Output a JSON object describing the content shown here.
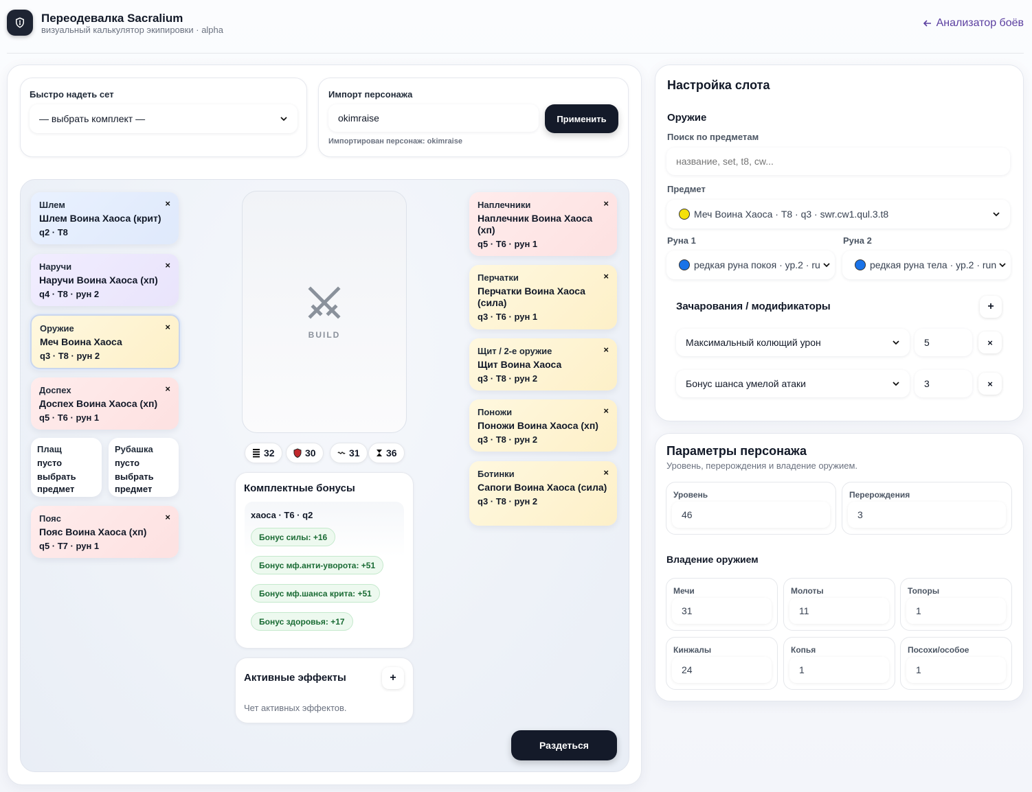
{
  "header": {
    "title": "Переодевалка Sacralium",
    "subtitle": "визуальный калькулятор экипировки · alpha",
    "back_link": "Анализатор боёв"
  },
  "quick_set": {
    "label": "Быстро надеть сет",
    "selected": "— выбрать комплект —"
  },
  "import": {
    "label": "Импорт персонажа",
    "value": "okimraise",
    "apply_button": "Применить",
    "status": "Импортирован персонаж: okimraise"
  },
  "slots_left": [
    {
      "slot": "Шлем",
      "item": "Шлем Воина Хаоса (крит)",
      "meta": "q2 · T8",
      "color": "blue"
    },
    {
      "slot": "Наручи",
      "item": "Наручи Воина Хаоса (хп)",
      "meta": "q4 · T8 · рун 2",
      "color": "purple"
    },
    {
      "slot": "Оружие",
      "item": "Меч Воина Хаоса",
      "meta": "q3 · T8 · рун 2",
      "color": "yellow",
      "selected": true
    },
    {
      "slot": "Доспех",
      "item": "Доспех Воина Хаоса (хп)",
      "meta": "q5 · T6 · рун 1",
      "color": "red"
    }
  ],
  "empty_slots": [
    {
      "slot": "Плащ",
      "state": "пусто",
      "hint_1": "выбрать",
      "hint_2": "предмет"
    },
    {
      "slot": "Рубашка",
      "state": "пусто",
      "hint_1": "выбрать",
      "hint_2": "предмет"
    }
  ],
  "belt": {
    "slot": "Пояс",
    "item": "Пояс Воина Хаоса (хп)",
    "meta": "q5 · T7 · рун 1",
    "color": "red"
  },
  "slots_right": [
    {
      "slot": "Наплечники",
      "item": "Наплечник Воина Хаоса (хп)",
      "meta": "q5 · T6 · рун 1",
      "color": "red"
    },
    {
      "slot": "Перчатки",
      "item": "Перчатки Воина Хаоса (сила)",
      "meta": "q3 · T6 · рун 1",
      "color": "yellow"
    },
    {
      "slot": "Щит / 2-е оружие",
      "item": "Щит Воина Хаоса",
      "meta": "q3 · T8 · рун 2",
      "color": "yellow"
    },
    {
      "slot": "Поножи",
      "item": "Поножи Воина Хаоса (хп)",
      "meta": "q3 · T8 · рун 2",
      "color": "yellow"
    },
    {
      "slot": "Ботинки",
      "item": "Сапоги Воина Хаоса (сила)",
      "meta": "q3 · T8 · рун 2",
      "color": "yellow"
    }
  ],
  "remove_symbol": "×",
  "build_label": "BUILD",
  "stats": [
    {
      "icon": "layers-icon",
      "value": "32"
    },
    {
      "icon": "shield-icon",
      "value": "30"
    },
    {
      "icon": "wave-icon",
      "value": "31"
    },
    {
      "icon": "hourglass-icon",
      "value": "36"
    }
  ],
  "set_bonuses": {
    "title": "Комплектные бонусы",
    "group": "хаоса · T6 · q2",
    "bonuses": [
      "Бонус силы: +16",
      "Бонус мф.анти-уворота: +51",
      "Бонус мф.шанса крита: +51",
      "Бонус здоровья: +17"
    ]
  },
  "effects": {
    "title": "Активные эффекты",
    "empty": "Чет активных эффектов."
  },
  "undress_button": "Раздеться",
  "slot_config": {
    "title": "Настройка слота",
    "slot_name": "Оружие",
    "search_label": "Поиск по предметам",
    "search_placeholder": "название, set, t8, cw...",
    "item_label": "Предмет",
    "item_value": "Меч Воина Хаоса · T8 · q3 · swr.cw1.qul.3.t8",
    "item_color": "#f5e10a",
    "rune1_label": "Руна 1",
    "rune1_value": "редкая руна покоя · ур.2 · ru",
    "rune1_color": "#1a73e8",
    "rune2_label": "Руна 2",
    "rune2_value": "редкая руна тела · ур.2 · run",
    "rune2_color": "#1a73e8",
    "enchant_title": "Зачарования / модификаторы",
    "enchants": [
      {
        "name": "Максимальный колющий урон",
        "value": "5"
      },
      {
        "name": "Бонус шанса умелой атаки",
        "value": "3"
      }
    ]
  },
  "character": {
    "title": "Параметры персонажа",
    "subtitle": "Уровень, перерождения и владение оружием.",
    "level_label": "Уровень",
    "level": "46",
    "rebirth_label": "Перерождения",
    "rebirth": "3",
    "mastery_title": "Владение оружием",
    "mastery": [
      {
        "label": "Мечи",
        "value": "31"
      },
      {
        "label": "Молоты",
        "value": "11"
      },
      {
        "label": "Топоры",
        "value": "1"
      },
      {
        "label": "Кинжалы",
        "value": "24"
      },
      {
        "label": "Копья",
        "value": "1"
      },
      {
        "label": "Посохи/особое",
        "value": "1"
      }
    ]
  }
}
